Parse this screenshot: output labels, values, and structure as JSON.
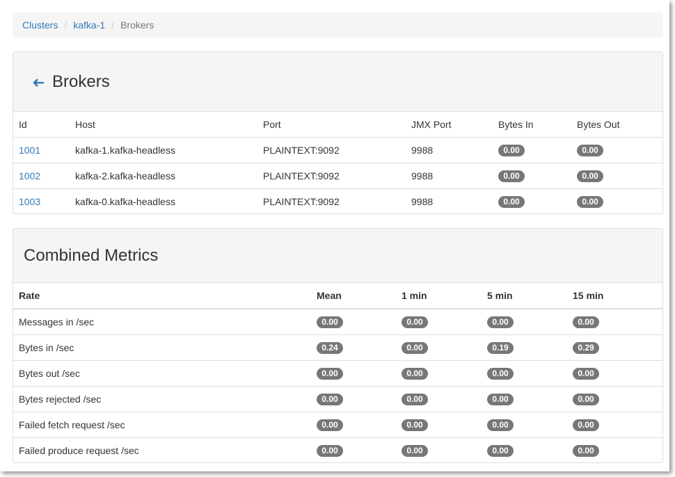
{
  "breadcrumb": {
    "items": [
      "Clusters",
      "kafka-1"
    ],
    "separator": "/",
    "current": "Brokers"
  },
  "brokers": {
    "title": "Brokers",
    "back_icon": "left-arrow-icon",
    "columns": [
      "Id",
      "Host",
      "Port",
      "JMX Port",
      "Bytes In",
      "Bytes Out"
    ],
    "rows": [
      {
        "id": "1001",
        "host": "kafka-1.kafka-headless",
        "port": "PLAINTEXT:9092",
        "jmx": "9988",
        "bytes_in": "0.00",
        "bytes_out": "0.00"
      },
      {
        "id": "1002",
        "host": "kafka-2.kafka-headless",
        "port": "PLAINTEXT:9092",
        "jmx": "9988",
        "bytes_in": "0.00",
        "bytes_out": "0.00"
      },
      {
        "id": "1003",
        "host": "kafka-0.kafka-headless",
        "port": "PLAINTEXT:9092",
        "jmx": "9988",
        "bytes_in": "0.00",
        "bytes_out": "0.00"
      }
    ]
  },
  "metrics": {
    "title": "Combined Metrics",
    "columns": [
      "Rate",
      "Mean",
      "1 min",
      "5 min",
      "15 min"
    ],
    "rows": [
      {
        "rate": "Messages in /sec",
        "mean": "0.00",
        "m1": "0.00",
        "m5": "0.00",
        "m15": "0.00"
      },
      {
        "rate": "Bytes in /sec",
        "mean": "0.24",
        "m1": "0.00",
        "m5": "0.19",
        "m15": "0.29"
      },
      {
        "rate": "Bytes out /sec",
        "mean": "0.00",
        "m1": "0.00",
        "m5": "0.00",
        "m15": "0.00"
      },
      {
        "rate": "Bytes rejected /sec",
        "mean": "0.00",
        "m1": "0.00",
        "m5": "0.00",
        "m15": "0.00"
      },
      {
        "rate": "Failed fetch request /sec",
        "mean": "0.00",
        "m1": "0.00",
        "m5": "0.00",
        "m15": "0.00"
      },
      {
        "rate": "Failed produce request /sec",
        "mean": "0.00",
        "m1": "0.00",
        "m5": "0.00",
        "m15": "0.00"
      }
    ]
  },
  "colors": {
    "link": "#337ab7",
    "badge": "#777777",
    "panel_heading": "#f5f5f5",
    "border": "#dddddd"
  }
}
